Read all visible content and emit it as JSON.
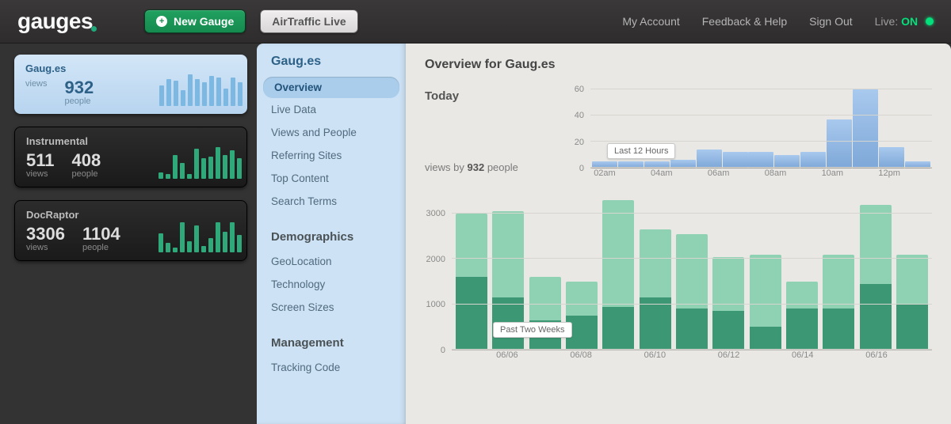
{
  "header": {
    "brand": "gauges",
    "new_gauge": "New Gauge",
    "airtraffic": "AirTraffic Live",
    "links": {
      "account": "My Account",
      "feedback": "Feedback & Help",
      "signout": "Sign Out"
    },
    "live_label": "Live:",
    "live_value": "ON"
  },
  "sites": [
    {
      "name": "Gaug.es",
      "views": 932,
      "views_text": "",
      "people": 932,
      "selected": true,
      "spark": [
        26,
        34,
        32,
        20,
        40,
        34,
        30,
        38,
        36,
        22,
        36,
        30
      ]
    },
    {
      "name": "Instrumental",
      "views": 511,
      "people": 408,
      "selected": false,
      "spark": [
        8,
        6,
        30,
        20,
        6,
        38,
        26,
        28,
        40,
        30,
        36,
        26
      ]
    },
    {
      "name": "DocRaptor",
      "views": 3306,
      "people": 1104,
      "selected": false,
      "spark": [
        24,
        12,
        6,
        38,
        14,
        34,
        8,
        18,
        38,
        26,
        38,
        22
      ]
    }
  ],
  "labels": {
    "views": "views",
    "people": "people"
  },
  "subnav": {
    "title": "Gaug.es",
    "group1": {
      "items": [
        "Overview",
        "Live Data",
        "Views and People",
        "Referring Sites",
        "Top Content",
        "Search Terms"
      ],
      "active": 0
    },
    "group2": {
      "title": "Demographics",
      "items": [
        "GeoLocation",
        "Technology",
        "Screen Sizes"
      ]
    },
    "group3": {
      "title": "Management",
      "items": [
        "Tracking Code"
      ]
    }
  },
  "overview": {
    "title": "Overview for Gaug.es",
    "today_label": "Today",
    "summary_prefix": "views by",
    "summary_value": "932",
    "summary_suffix": "people",
    "hourly_badge": "Last 12 Hours",
    "weeks_badge": "Past Two Weeks"
  },
  "chart_data": [
    {
      "type": "bar",
      "name": "hourly",
      "title": "Last 12 Hours",
      "ylabel": "views",
      "ylim": [
        0,
        60
      ],
      "yticks": [
        0,
        20,
        40,
        60
      ],
      "categories": [
        "02am",
        "",
        "04am",
        "",
        "06am",
        "",
        "08am",
        "",
        "10am",
        "",
        "12pm",
        ""
      ],
      "series": [
        {
          "name": "views",
          "values": [
            5,
            5,
            5,
            6,
            14,
            12,
            12,
            10,
            12,
            37,
            60,
            16,
            5
          ]
        }
      ]
    },
    {
      "type": "bar",
      "name": "two_weeks",
      "title": "Past Two Weeks",
      "ylabel": "",
      "ylim": [
        0,
        3300
      ],
      "yticks": [
        0,
        1000,
        2000,
        3000
      ],
      "categories": [
        "",
        "06/06",
        "",
        "06/08",
        "",
        "06/10",
        "",
        "06/12",
        "",
        "06/14",
        "",
        "06/16",
        ""
      ],
      "series": [
        {
          "name": "views",
          "values": [
            3000,
            3050,
            1600,
            1500,
            3300,
            2650,
            2550,
            2050,
            2100,
            1500,
            2100,
            3200,
            2100
          ]
        },
        {
          "name": "people",
          "values": [
            1600,
            1150,
            650,
            750,
            950,
            1150,
            900,
            850,
            500,
            900,
            900,
            1450,
            1000
          ]
        }
      ]
    }
  ]
}
